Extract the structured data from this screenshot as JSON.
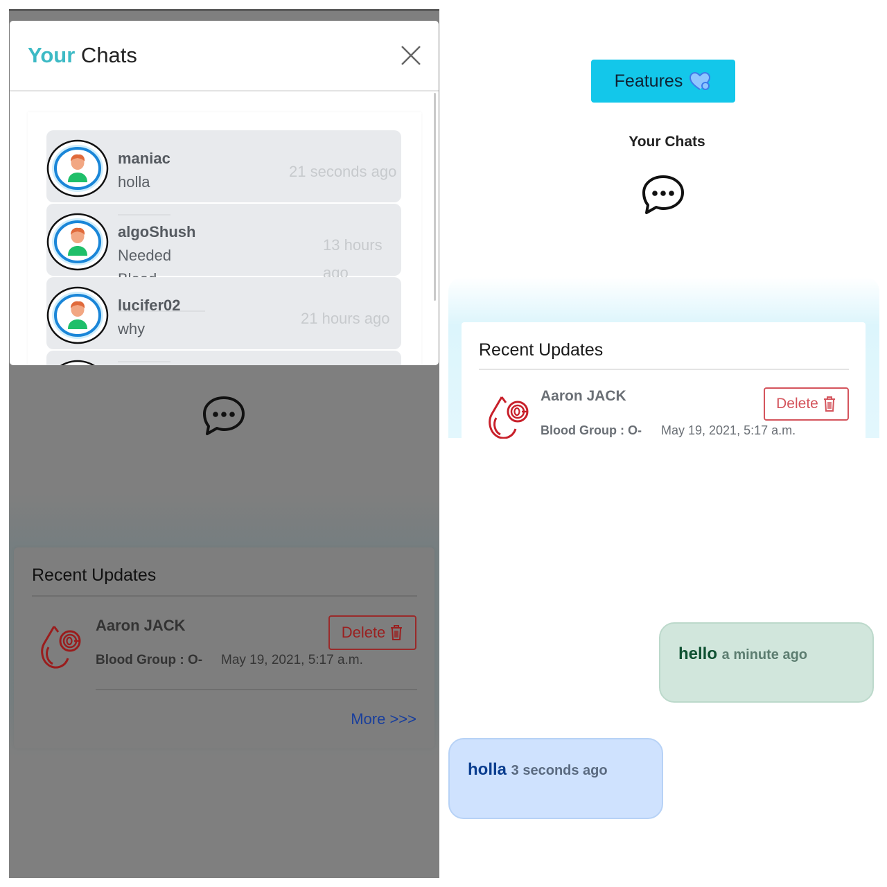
{
  "left_screen": {
    "modal": {
      "title_accent": "Your",
      "title_rest": " Chats",
      "close_icon": "close-icon",
      "chats": [
        {
          "name": "maniac",
          "message": "holla",
          "time": "21 seconds ago"
        },
        {
          "name": "algoShush",
          "message": "Needed Blood",
          "time": "13 hours ago"
        },
        {
          "name": "lucifer02",
          "message": "why",
          "time": "21 hours ago"
        }
      ]
    },
    "background": {
      "chat_icon": "chat-bubble-dots-icon",
      "recent_updates": {
        "title": "Recent Updates",
        "item": {
          "name": "Aaron JACK",
          "blood_group": "Blood Group : O-",
          "date": "May 19, 2021, 5:17 a.m.",
          "delete_label": "Delete"
        },
        "more_label": "More >>>"
      }
    }
  },
  "right_screen": {
    "features_label": "Features",
    "chats_title": "Your Chats",
    "recent_updates": {
      "title": "Recent Updates",
      "item": {
        "name": "Aaron JACK",
        "blood_group": "Blood Group : O-",
        "date": "May 19, 2021, 5:17 a.m.",
        "delete_label": "Delete"
      }
    },
    "messages": [
      {
        "direction": "sent",
        "text": "hello",
        "time": "a minute ago"
      },
      {
        "direction": "received",
        "text": "holla",
        "time": "3 seconds ago"
      }
    ]
  },
  "colors": {
    "accent_teal": "#3dbac5",
    "features_button": "#13c7ea",
    "delete_red": "#d4545c",
    "sent_bubble": "#d1e6dc",
    "received_bubble": "#cfe2fe",
    "more_link": "#1a3f9c"
  }
}
